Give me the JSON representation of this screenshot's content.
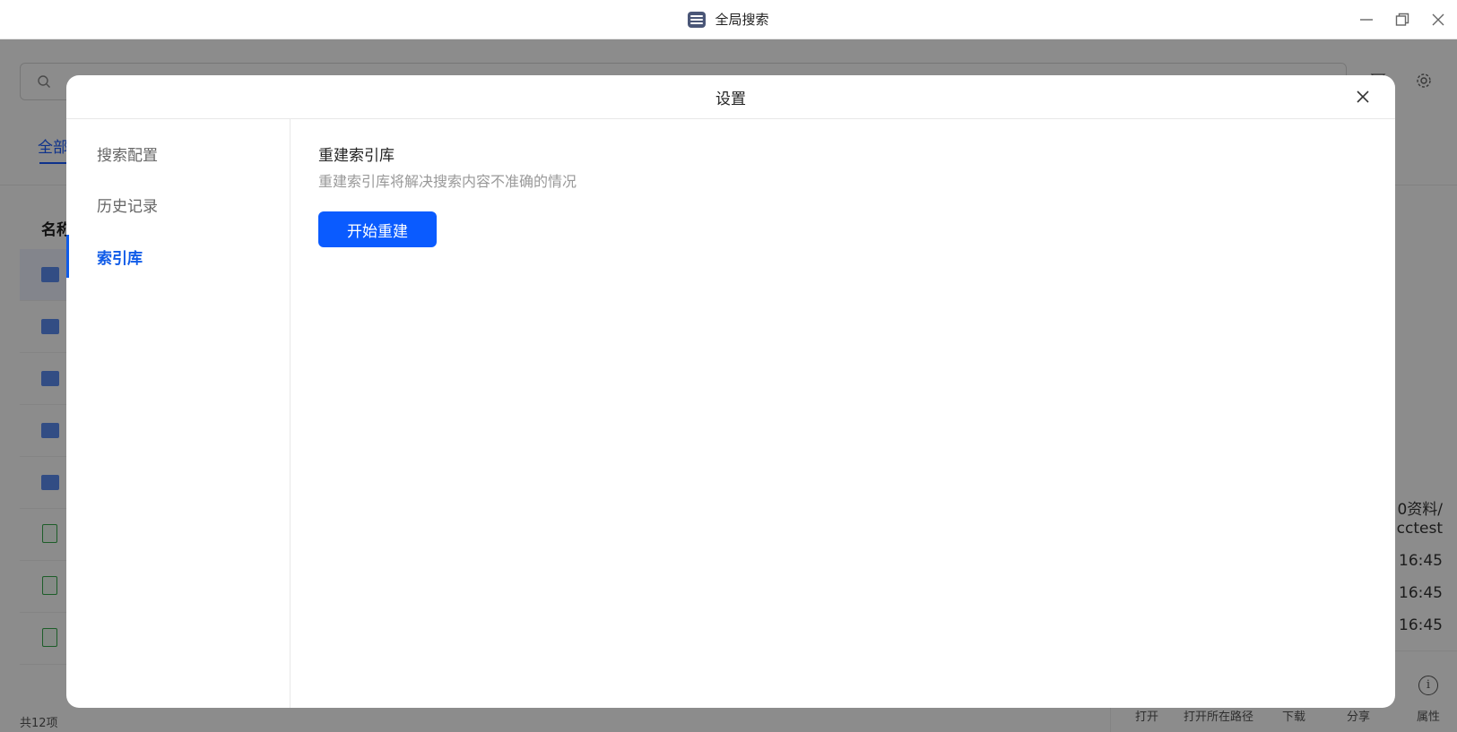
{
  "window": {
    "title": "全局搜索",
    "minimize_symbol": "—",
    "maximize_symbol": "❐",
    "close_symbol": "✕"
  },
  "background": {
    "search_placeholder": "",
    "tab_all": "全部",
    "column_name": "名称",
    "right_panel": {
      "path_line1": "0资料/",
      "path_line2": "cctest",
      "time1": "16:45",
      "time2": "16:45",
      "time3": "16:45"
    },
    "tools": [
      "打开",
      "打开所在路径",
      "下载",
      "分享",
      "属性"
    ],
    "count_text": "共12项"
  },
  "dialog": {
    "title": "设置",
    "sidebar": [
      {
        "label": "搜索配置",
        "active": false
      },
      {
        "label": "历史记录",
        "active": false
      },
      {
        "label": "索引库",
        "active": true
      }
    ],
    "section": {
      "title": "重建索引库",
      "description": "重建索引库将解决搜索内容不准确的情况",
      "button_label": "开始重建"
    }
  },
  "colors": {
    "accent": "#0a5bff",
    "overlay": "rgba(0,0,0,0.45)"
  },
  "icons": [
    "app-logo-icon",
    "minimize-icon",
    "maximize-icon",
    "window-close-icon",
    "search-icon",
    "filter-icon",
    "gear-icon",
    "folder-icon",
    "document-icon",
    "info-icon",
    "dialog-close-icon"
  ]
}
